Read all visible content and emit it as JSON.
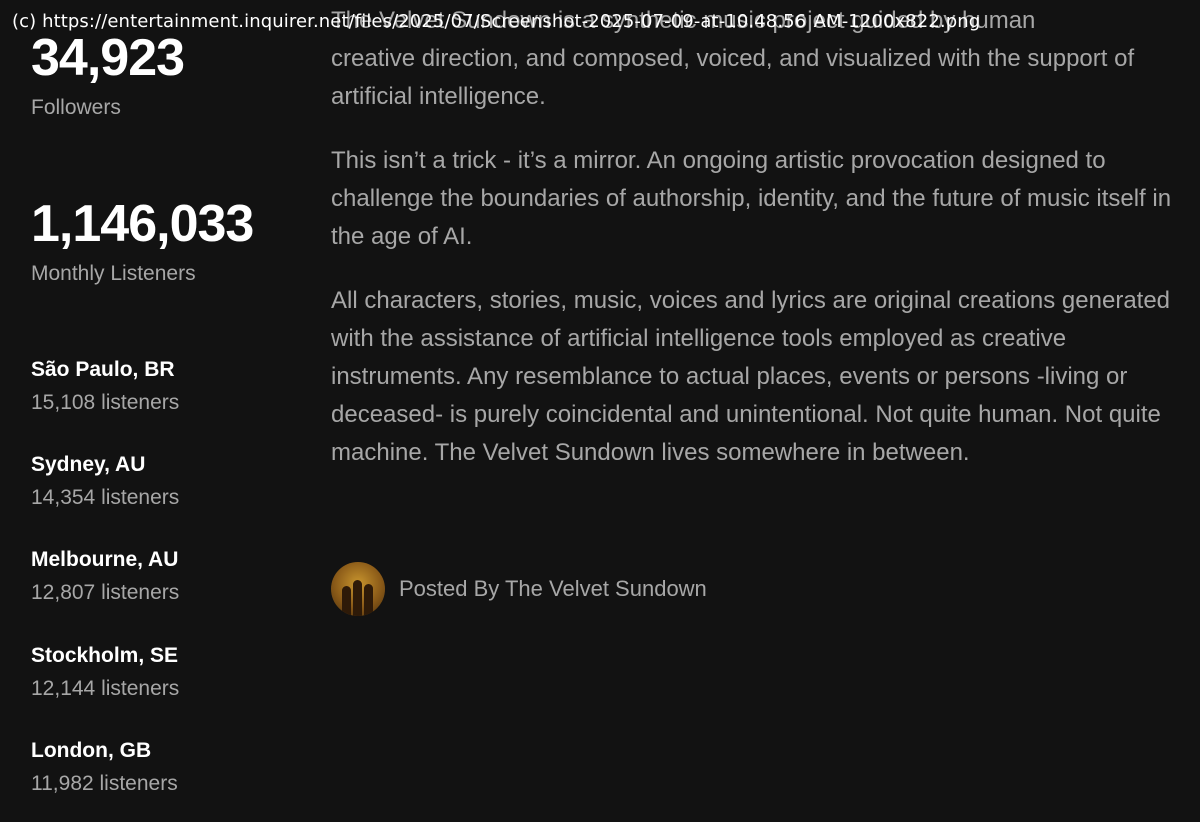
{
  "watermark": "(c) https://entertainment.inquirer.net/files/2025/07/Screenshot-2025-07-09-at-10.48.56  AM-1200x822.png",
  "stats": {
    "followers_value": "34,923",
    "followers_label": "Followers",
    "monthly_listeners_value": "1,146,033",
    "monthly_listeners_label": "Monthly Listeners"
  },
  "cities": [
    {
      "name": "São Paulo, BR",
      "listeners": "15,108 listeners"
    },
    {
      "name": "Sydney, AU",
      "listeners": "14,354 listeners"
    },
    {
      "name": "Melbourne, AU",
      "listeners": "12,807 listeners"
    },
    {
      "name": "Stockholm, SE",
      "listeners": "12,144 listeners"
    },
    {
      "name": "London, GB",
      "listeners": "11,982 listeners"
    }
  ],
  "bio": {
    "clipped_line": "The Velvet Sundown is a synthetic music project guided by human",
    "paragraph_1": "creative direction, and composed, voiced, and visualized with the support of artificial intelligence.",
    "paragraph_2": "This isn’t a trick - it’s a mirror. An ongoing artistic provocation designed to challenge the boundaries of authorship, identity, and the future of music itself in the age of AI.",
    "paragraph_3": "All characters, stories, music, voices and lyrics are original creations generated with the assistance of artificial intelligence tools employed as creative instruments. Any resemblance to actual places, events or persons -living or deceased- is purely coincidental and unintentional. Not quite human. Not quite machine. The Velvet Sundown lives somewhere in between."
  },
  "posted_by": {
    "label": "Posted By The Velvet Sundown"
  },
  "colors": {
    "background": "#121212",
    "primary_text": "#ffffff",
    "secondary_text": "#a7a7a7"
  }
}
